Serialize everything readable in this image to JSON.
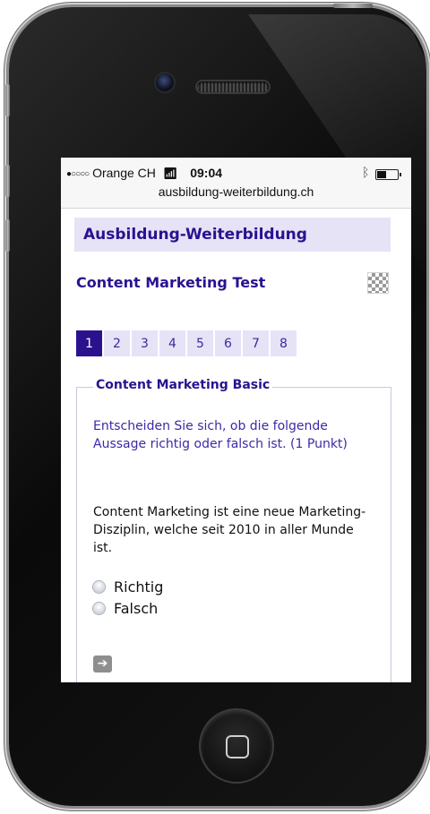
{
  "status_bar": {
    "signal": "●○○○○",
    "carrier": "Orange CH",
    "time": "09:04",
    "url": "ausbildung-weiterbildung.ch"
  },
  "site": {
    "header_title": "Ausbildung-Weiterbildung",
    "quiz_title": "Content Marketing Test"
  },
  "pager": {
    "pages": [
      "1",
      "2",
      "3",
      "4",
      "5",
      "6",
      "7",
      "8"
    ],
    "active": "1"
  },
  "question": {
    "section_title": "Content Marketing Basic",
    "instruction": "Entscheiden Sie sich, ob die folgende Aussage richtig oder falsch ist. (1 Punkt)",
    "statement": "Content Marketing ist eine neue Marketing-Disziplin, welche seit 2010 in aller Munde ist.",
    "options": [
      {
        "label": "Richtig"
      },
      {
        "label": "Falsch"
      }
    ]
  },
  "icons": {
    "next": "arrow-right-icon",
    "checker": "checkered-flag-icon"
  }
}
